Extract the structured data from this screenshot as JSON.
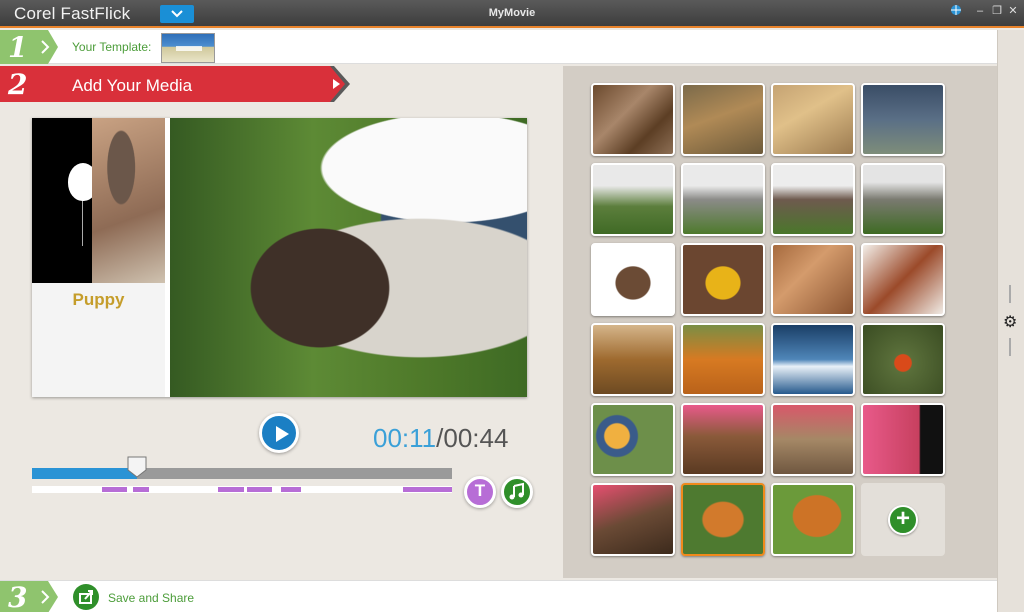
{
  "app": {
    "title": "Corel FastFlick",
    "movie_title": "MyMovie"
  },
  "window_controls": [
    "globe-icon",
    "minimize-icon",
    "restore-icon",
    "close-icon"
  ],
  "steps": {
    "step1": {
      "number": "1",
      "label": "Your Template:"
    },
    "step2": {
      "number": "2",
      "label": "Add Your Media"
    },
    "step3": {
      "number": "3",
      "label": "Save and Share"
    }
  },
  "preview": {
    "caption": "Puppy"
  },
  "playback": {
    "current_time": "00:11",
    "separator": "/",
    "total_time": "00:44",
    "progress": 0.25
  },
  "timeline": {
    "title_button": "T",
    "music_button": "music-note-icon"
  },
  "media": {
    "items": [
      {
        "name": "logs-in-forest"
      },
      {
        "name": "autumn-forest-path"
      },
      {
        "name": "autumn-woods-dog"
      },
      {
        "name": "puppy-sitting"
      },
      {
        "name": "puppy-held-1"
      },
      {
        "name": "puppy-held-2"
      },
      {
        "name": "puppy-held-3"
      },
      {
        "name": "puppy-held-4"
      },
      {
        "name": "puppy-portrait-white"
      },
      {
        "name": "yellow-toy"
      },
      {
        "name": "dry-leaves-1"
      },
      {
        "name": "dry-leaves-2"
      },
      {
        "name": "autumn-tree"
      },
      {
        "name": "orange-shrubs"
      },
      {
        "name": "ocean-wave"
      },
      {
        "name": "red-leaf-moss"
      },
      {
        "name": "stained-glass-flowers"
      },
      {
        "name": "pink-blossoms-eaves"
      },
      {
        "name": "blossoms-window"
      },
      {
        "name": "pink-blossoms-dark"
      },
      {
        "name": "blossoms-building"
      },
      {
        "name": "shiba-dog-1",
        "selected": true
      },
      {
        "name": "shiba-dog-2"
      }
    ],
    "add_label": "add-media-icon"
  },
  "colors": {
    "accent_orange": "#e8822a",
    "step_green": "#8fc46e",
    "step_red": "#d9303a",
    "play_blue": "#1b7fc4",
    "time_blue": "#3aa0d8",
    "purple": "#b76dd6"
  }
}
